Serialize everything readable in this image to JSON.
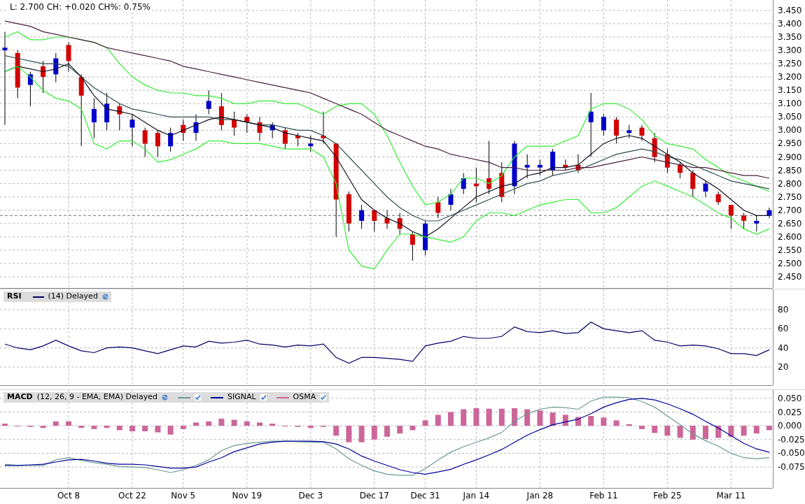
{
  "price_panel": {
    "readout": "L: 2.700 CH: +0.020 CH%: 0.75%",
    "chart_data": {
      "type": "candlestick",
      "grid": true,
      "ylim": [
        2.408,
        3.489
      ],
      "yticks": [
        {
          "value": 2.45,
          "label": "2.450"
        },
        {
          "value": 2.5,
          "label": "2.500"
        },
        {
          "value": 2.55,
          "label": "2.550"
        },
        {
          "value": 2.6,
          "label": "2.600"
        },
        {
          "value": 2.65,
          "label": "2.650"
        },
        {
          "value": 2.7,
          "label": "2.700"
        },
        {
          "value": 2.75,
          "label": "2.750"
        },
        {
          "value": 2.8,
          "label": "2.800"
        },
        {
          "value": 2.85,
          "label": "2.850"
        },
        {
          "value": 2.9,
          "label": "2.900"
        },
        {
          "value": 2.95,
          "label": "2.950"
        },
        {
          "value": 3.0,
          "label": "3.000"
        },
        {
          "value": 3.05,
          "label": "3.050"
        },
        {
          "value": 3.1,
          "label": "3.100"
        },
        {
          "value": 3.15,
          "label": "3.150"
        },
        {
          "value": 3.2,
          "label": "3.200"
        },
        {
          "value": 3.25,
          "label": "3.250"
        },
        {
          "value": 3.3,
          "label": "3.300"
        },
        {
          "value": 3.35,
          "label": "3.350"
        },
        {
          "value": 3.4,
          "label": "3.400"
        },
        {
          "value": 3.45,
          "label": "3.450"
        }
      ],
      "ref_lines": [
        {
          "axis": "y",
          "value": 2.68
        }
      ],
      "ohlc": [
        [
          3.3,
          3.37,
          3.02,
          3.31
        ],
        [
          3.29,
          3.3,
          3.12,
          3.16
        ],
        [
          3.17,
          3.22,
          3.09,
          3.21
        ],
        [
          3.24,
          3.26,
          3.14,
          3.2
        ],
        [
          3.21,
          3.29,
          3.18,
          3.27
        ],
        [
          3.32,
          3.33,
          3.22,
          3.26
        ],
        [
          3.2,
          3.21,
          2.94,
          3.13
        ],
        [
          3.03,
          3.12,
          2.97,
          3.08
        ],
        [
          3.03,
          3.14,
          3.0,
          3.1
        ],
        [
          3.09,
          3.1,
          3.0,
          3.06
        ],
        [
          3.01,
          3.06,
          2.94,
          3.04
        ],
        [
          3.0,
          3.01,
          2.9,
          2.95
        ],
        [
          2.99,
          3.0,
          2.9,
          2.94
        ],
        [
          2.94,
          3.01,
          2.92,
          2.99
        ],
        [
          3.02,
          3.04,
          2.96,
          2.99
        ],
        [
          2.99,
          3.06,
          2.96,
          3.03
        ],
        [
          3.08,
          3.15,
          3.06,
          3.11
        ],
        [
          3.09,
          3.14,
          3.0,
          3.02
        ],
        [
          3.04,
          3.07,
          2.98,
          3.01
        ],
        [
          3.05,
          3.06,
          2.99,
          3.03
        ],
        [
          3.03,
          3.05,
          2.96,
          2.99
        ],
        [
          3.0,
          3.03,
          2.97,
          3.02
        ],
        [
          3.0,
          3.01,
          2.93,
          2.95
        ],
        [
          2.98,
          2.99,
          2.94,
          2.97
        ],
        [
          2.94,
          2.98,
          2.92,
          2.95
        ],
        [
          2.98,
          3.07,
          2.95,
          2.97
        ],
        [
          2.95,
          2.95,
          2.6,
          2.74
        ],
        [
          2.76,
          2.77,
          2.62,
          2.65
        ],
        [
          2.66,
          2.72,
          2.63,
          2.7
        ],
        [
          2.7,
          2.7,
          2.62,
          2.66
        ],
        [
          2.67,
          2.7,
          2.63,
          2.65
        ],
        [
          2.67,
          2.69,
          2.61,
          2.63
        ],
        [
          2.61,
          2.62,
          2.51,
          2.57
        ],
        [
          2.55,
          2.66,
          2.53,
          2.65
        ],
        [
          2.73,
          2.75,
          2.67,
          2.69
        ],
        [
          2.72,
          2.78,
          2.7,
          2.76
        ],
        [
          2.78,
          2.84,
          2.76,
          2.82
        ],
        [
          2.8,
          2.86,
          2.73,
          2.79
        ],
        [
          2.82,
          2.96,
          2.76,
          2.78
        ],
        [
          2.84,
          2.88,
          2.73,
          2.75
        ],
        [
          2.79,
          2.96,
          2.76,
          2.95
        ],
        [
          2.86,
          2.91,
          2.82,
          2.87
        ],
        [
          2.86,
          2.89,
          2.83,
          2.87
        ],
        [
          2.85,
          2.93,
          2.83,
          2.92
        ],
        [
          2.87,
          2.89,
          2.85,
          2.86
        ],
        [
          2.87,
          2.91,
          2.84,
          2.85
        ],
        [
          3.03,
          3.14,
          2.9,
          3.07
        ],
        [
          3.0,
          3.06,
          2.98,
          3.05
        ],
        [
          3.04,
          3.05,
          2.95,
          2.98
        ],
        [
          2.99,
          3.02,
          2.97,
          3.0
        ],
        [
          3.01,
          3.02,
          2.96,
          2.98
        ],
        [
          2.97,
          2.99,
          2.88,
          2.9
        ],
        [
          2.91,
          2.93,
          2.84,
          2.86
        ],
        [
          2.87,
          2.88,
          2.82,
          2.84
        ],
        [
          2.84,
          2.85,
          2.75,
          2.78
        ],
        [
          2.77,
          2.81,
          2.75,
          2.8
        ],
        [
          2.76,
          2.77,
          2.72,
          2.73
        ],
        [
          2.72,
          2.72,
          2.63,
          2.68
        ],
        [
          2.68,
          2.69,
          2.63,
          2.66
        ],
        [
          2.65,
          2.68,
          2.62,
          2.66
        ],
        [
          2.68,
          2.71,
          2.67,
          2.7
        ]
      ],
      "series": [
        {
          "type": "line",
          "color": "#33ee33",
          "values": [
            3.35,
            3.37,
            3.34,
            3.34,
            3.35,
            3.35,
            3.34,
            3.33,
            3.31,
            3.25,
            3.2,
            3.17,
            3.15,
            3.14,
            3.14,
            3.13,
            3.13,
            3.12,
            3.1,
            3.1,
            3.11,
            3.11,
            3.1,
            3.1,
            3.08,
            3.06,
            3.09,
            3.1,
            3.1,
            3.06,
            2.98,
            2.88,
            2.79,
            2.72,
            2.73,
            2.76,
            2.82,
            2.82,
            2.8,
            2.83,
            2.9,
            2.94,
            2.94,
            2.94,
            2.96,
            2.98,
            3.08,
            3.1,
            3.1,
            3.08,
            3.04,
            2.98,
            2.95,
            2.94,
            2.93,
            2.89,
            2.86,
            2.83,
            2.81,
            2.79,
            2.77
          ]
        },
        {
          "type": "line",
          "color": "#2f4f4f",
          "values": [
            3.28,
            3.27,
            3.26,
            3.25,
            3.25,
            3.24,
            3.2,
            3.16,
            3.13,
            3.1,
            3.08,
            3.07,
            3.06,
            3.05,
            3.05,
            3.05,
            3.05,
            3.04,
            3.04,
            3.03,
            3.02,
            3.02,
            3.01,
            3.0,
            3.0,
            2.98,
            2.95,
            2.9,
            2.85,
            2.8,
            2.75,
            2.71,
            2.68,
            2.66,
            2.66,
            2.68,
            2.7,
            2.72,
            2.74,
            2.76,
            2.78,
            2.8,
            2.81,
            2.83,
            2.84,
            2.85,
            2.87,
            2.89,
            2.91,
            2.92,
            2.93,
            2.92,
            2.9,
            2.89,
            2.87,
            2.85,
            2.83,
            2.81,
            2.8,
            2.79,
            2.78
          ]
        },
        {
          "type": "line",
          "color": "#111122",
          "values": [
            3.22,
            3.24,
            3.23,
            3.22,
            3.23,
            3.25,
            3.2,
            3.13,
            3.08,
            3.07,
            3.06,
            3.03,
            3.0,
            2.98,
            3.0,
            3.02,
            3.04,
            3.05,
            3.04,
            3.03,
            3.02,
            3.01,
            2.99,
            2.98,
            2.97,
            2.96,
            2.9,
            2.82,
            2.74,
            2.7,
            2.67,
            2.65,
            2.62,
            2.6,
            2.63,
            2.67,
            2.71,
            2.75,
            2.77,
            2.79,
            2.8,
            2.83,
            2.84,
            2.86,
            2.86,
            2.87,
            2.91,
            2.95,
            2.97,
            2.98,
            2.97,
            2.94,
            2.91,
            2.88,
            2.84,
            2.81,
            2.78,
            2.74,
            2.7,
            2.68,
            2.68
          ]
        },
        {
          "type": "line",
          "color": "#4b1f3f",
          "values": [
            3.41,
            3.4,
            3.39,
            3.37,
            3.36,
            3.35,
            3.34,
            3.33,
            3.31,
            3.3,
            3.29,
            3.28,
            3.27,
            3.26,
            3.24,
            3.23,
            3.22,
            3.21,
            3.2,
            3.19,
            3.18,
            3.17,
            3.16,
            3.15,
            3.14,
            3.12,
            3.1,
            3.08,
            3.06,
            3.03,
            3.0,
            2.98,
            2.96,
            2.94,
            2.93,
            2.91,
            2.9,
            2.89,
            2.88,
            2.86,
            2.86,
            2.85,
            2.85,
            2.85,
            2.85,
            2.86,
            2.86,
            2.87,
            2.88,
            2.89,
            2.9,
            2.89,
            2.88,
            2.87,
            2.86,
            2.86,
            2.85,
            2.84,
            2.83,
            2.83,
            2.82
          ]
        },
        {
          "type": "line",
          "color": "#33ee33",
          "values": [
            3.22,
            3.24,
            3.2,
            3.15,
            3.12,
            3.11,
            3.08,
            2.95,
            2.93,
            2.96,
            2.96,
            2.93,
            2.88,
            2.89,
            2.91,
            2.93,
            2.96,
            2.96,
            2.95,
            2.95,
            2.95,
            2.94,
            2.93,
            2.93,
            2.93,
            2.9,
            2.8,
            2.55,
            2.49,
            2.48,
            2.55,
            2.61,
            2.61,
            2.6,
            2.59,
            2.58,
            2.6,
            2.66,
            2.69,
            2.69,
            2.68,
            2.7,
            2.72,
            2.73,
            2.74,
            2.74,
            2.69,
            2.69,
            2.71,
            2.75,
            2.79,
            2.81,
            2.79,
            2.77,
            2.75,
            2.72,
            2.69,
            2.67,
            2.63,
            2.61,
            2.63
          ]
        }
      ]
    }
  },
  "rsi_panel": {
    "params": "(14) Delayed",
    "chart_data": {
      "type": "line",
      "grid": true,
      "ylim": [
        1,
        101.2
      ],
      "yticks": [
        {
          "value": 20,
          "label": "20"
        },
        {
          "value": 40,
          "label": "40"
        },
        {
          "value": 60,
          "label": "60"
        },
        {
          "value": 80,
          "label": "80"
        }
      ],
      "series": [
        {
          "name": "RSI",
          "color": "#000066",
          "values": [
            44,
            40,
            38,
            42,
            48,
            42,
            37,
            35,
            40,
            41,
            40,
            37,
            34,
            38,
            42,
            41,
            47,
            45,
            46,
            48,
            44,
            43,
            41,
            43,
            42,
            44,
            30,
            24,
            30,
            30,
            29,
            28,
            26,
            42,
            45,
            47,
            52,
            50,
            50,
            52,
            62,
            57,
            56,
            58,
            55,
            56,
            67,
            60,
            58,
            56,
            58,
            48,
            46,
            42,
            43,
            42,
            39,
            34,
            34,
            32,
            38
          ]
        }
      ]
    }
  },
  "macd_panel": {
    "label": "MACD",
    "params": "(12, 26, 9 - EMA, EMA) Delayed",
    "legend": [
      {
        "checked": true
      },
      {
        "checked": true
      },
      {
        "checked": true
      }
    ],
    "chart_data": {
      "type": "line",
      "grid": true,
      "legend": "upper left",
      "ylim": [
        -0.113,
        0.065
      ],
      "categories": [
        null,
        null,
        null,
        null,
        null,
        "Oct 8",
        null,
        null,
        null,
        null,
        "Oct 22",
        null,
        null,
        null,
        "Nov 5",
        null,
        null,
        null,
        null,
        "Nov 19",
        null,
        null,
        null,
        null,
        "Dec 3",
        null,
        null,
        null,
        null,
        "Dec 17",
        null,
        null,
        null,
        "Dec 31",
        null,
        null,
        null,
        "Jan 14",
        null,
        null,
        null,
        null,
        "Jan 28",
        null,
        null,
        null,
        null,
        "Feb 11",
        null,
        null,
        null,
        null,
        "Feb 25",
        null,
        null,
        null,
        null,
        "Mar 11",
        null,
        null,
        null
      ],
      "yticks": [
        {
          "value": -0.075,
          "label": "-0.075"
        },
        {
          "value": -0.05,
          "label": "-0.050"
        },
        {
          "value": -0.025,
          "label": "-0.025"
        },
        {
          "value": 0,
          "label": "0.000"
        },
        {
          "value": 0.025,
          "label": "0.025"
        },
        {
          "value": 0.05,
          "label": "0.050"
        }
      ],
      "series": [
        {
          "type": "line",
          "color": "#6a9a94",
          "values": [
            -0.07,
            -0.072,
            -0.072,
            -0.072,
            -0.062,
            -0.058,
            -0.063,
            -0.067,
            -0.07,
            -0.074,
            -0.075,
            -0.076,
            -0.08,
            -0.085,
            -0.08,
            -0.072,
            -0.062,
            -0.045,
            -0.036,
            -0.032,
            -0.03,
            -0.028,
            -0.028,
            -0.029,
            -0.03,
            -0.03,
            -0.042,
            -0.06,
            -0.072,
            -0.082,
            -0.088,
            -0.09,
            -0.09,
            -0.078,
            -0.062,
            -0.048,
            -0.038,
            -0.03,
            -0.022,
            -0.012,
            0.008,
            0.022,
            0.03,
            0.034,
            0.033,
            0.03,
            0.045,
            0.052,
            0.052,
            0.051,
            0.044,
            0.034,
            0.018,
            0.002,
            -0.015,
            -0.027,
            -0.037,
            -0.05,
            -0.058,
            -0.06,
            -0.058
          ]
        },
        {
          "name": "SIGNAL",
          "type": "line",
          "color": "#000099",
          "values": [
            -0.072,
            -0.072,
            -0.071,
            -0.07,
            -0.066,
            -0.062,
            -0.061,
            -0.064,
            -0.068,
            -0.07,
            -0.07,
            -0.071,
            -0.074,
            -0.077,
            -0.077,
            -0.075,
            -0.066,
            -0.058,
            -0.047,
            -0.04,
            -0.033,
            -0.03,
            -0.028,
            -0.028,
            -0.028,
            -0.029,
            -0.033,
            -0.042,
            -0.055,
            -0.064,
            -0.072,
            -0.08,
            -0.085,
            -0.088,
            -0.084,
            -0.079,
            -0.07,
            -0.062,
            -0.053,
            -0.043,
            -0.03,
            -0.017,
            -0.007,
            0.002,
            0.007,
            0.012,
            0.022,
            0.034,
            0.042,
            0.048,
            0.05,
            0.047,
            0.04,
            0.031,
            0.021,
            0.008,
            -0.004,
            -0.018,
            -0.032,
            -0.042,
            -0.048
          ]
        },
        {
          "name": "OSMA",
          "type": "bar",
          "color": "#cc6699",
          "values": [
            0.004,
            0.0,
            -0.002,
            -0.004,
            0.008,
            0.008,
            -0.004,
            -0.006,
            -0.004,
            -0.008,
            -0.01,
            -0.01,
            -0.012,
            -0.016,
            -0.006,
            0.006,
            0.008,
            0.013,
            0.011,
            0.008,
            0.006,
            0.004,
            0.0,
            -0.002,
            -0.004,
            -0.002,
            -0.018,
            -0.03,
            -0.03,
            -0.025,
            -0.02,
            -0.014,
            -0.008,
            0.01,
            0.02,
            0.025,
            0.03,
            0.032,
            0.031,
            0.031,
            0.032,
            0.03,
            0.028,
            0.024,
            0.02,
            0.016,
            0.018,
            0.015,
            0.01,
            0.003,
            -0.006,
            -0.013,
            -0.018,
            -0.022,
            -0.025,
            -0.024,
            -0.022,
            -0.02,
            -0.018,
            -0.014,
            -0.008
          ]
        }
      ]
    }
  }
}
